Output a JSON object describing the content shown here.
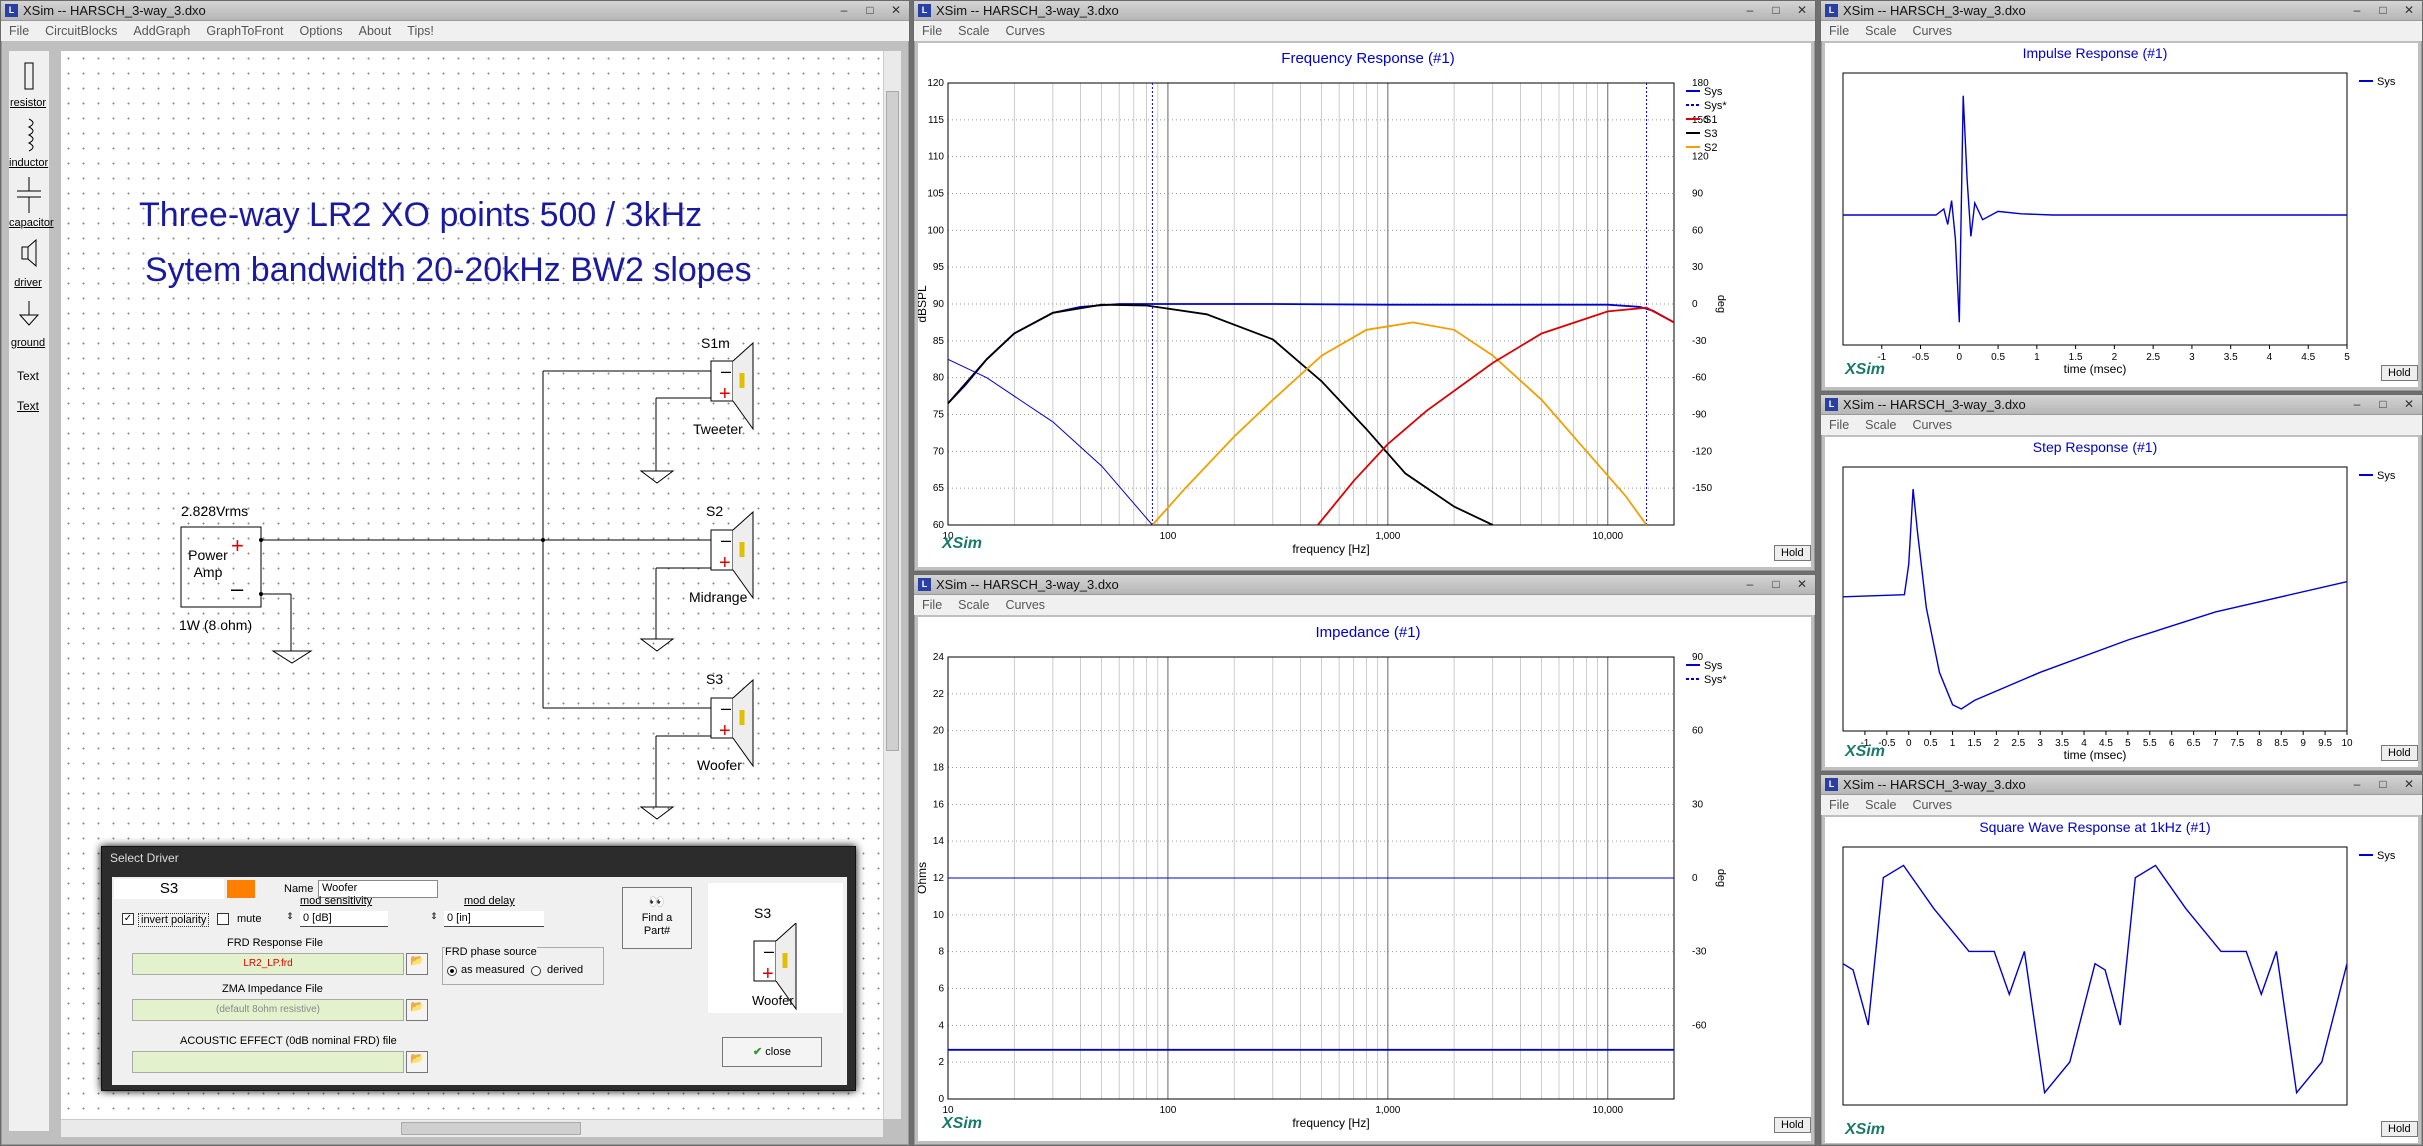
{
  "windows": {
    "circuit": {
      "title": "XSim -- HARSCH_3-way_3.dxo",
      "menu": [
        "File",
        "CircuitBlocks",
        "AddGraph",
        "GraphToFront",
        "Options",
        "About",
        "Tips!"
      ]
    },
    "freq": {
      "title": "XSim -- HARSCH_3-way_3.dxo",
      "menu": [
        "File",
        "Scale",
        "Curves"
      ]
    },
    "impedance": {
      "title": "XSim -- HARSCH_3-way_3.dxo",
      "menu": [
        "File",
        "Scale",
        "Curves"
      ]
    },
    "impulse": {
      "title": "XSim -- HARSCH_3-way_3.dxo",
      "menu": [
        "File",
        "Scale",
        "Curves"
      ]
    },
    "step": {
      "title": "XSim -- HARSCH_3-way_3.dxo",
      "menu": [
        "File",
        "Scale",
        "Curves"
      ]
    },
    "square": {
      "title": "XSim -- HARSCH_3-way_3.dxo",
      "menu": [
        "File",
        "Scale",
        "Curves"
      ]
    }
  },
  "toolbox": [
    "resistor",
    "inductor",
    "capacitor",
    "driver",
    "ground",
    "Text",
    "Text"
  ],
  "circuit": {
    "heading1": "Three-way LR2 XO points 500 / 3kHz",
    "heading2": "Sytem bandwidth 20-20kHz BW2 slopes",
    "amp_voltage": "2.828Vrms",
    "amp_label1": "Power",
    "amp_label2": "Amp",
    "amp_power": "1W (8 ohm)",
    "drivers": [
      {
        "id": "S1m",
        "name": "Tweeter"
      },
      {
        "id": "S2",
        "name": "Midrange"
      },
      {
        "id": "S3",
        "name": "Woofer"
      }
    ]
  },
  "dialog": {
    "title": "Select Driver",
    "driver_id": "S3",
    "color": "#ff8000",
    "name_label": "Name",
    "name_value": "Woofer",
    "mod_sensitivity_label": "mod sensitivity",
    "mod_sensitivity_value": "0 [dB]",
    "mod_delay_label": "mod delay",
    "mod_delay_value": "0 [in]",
    "invert_polarity": "invert polarity",
    "mute": "mute",
    "frd_label": "FRD Response File",
    "frd_value": "LR2_LP.frd",
    "zma_label": "ZMA Impedance File",
    "zma_value": "(default 8ohm resistive)",
    "acoustic_label": "ACOUSTIC EFFECT (0dB nominal FRD) file",
    "acoustic_value": "",
    "phase_source_label": "FRD phase source",
    "phase_measured": "as measured",
    "phase_derived": "derived",
    "find_part": "Find a Part#",
    "preview_id": "S3",
    "preview_name": "Woofer",
    "close": "close"
  },
  "brand": "XSim",
  "hold": "Hold",
  "colors": {
    "sys": "#0000cc",
    "s1": "#dd0000",
    "s3": "#000000",
    "s2": "#f0a000",
    "title": "#0000cc"
  },
  "chart_data": [
    {
      "type": "line",
      "title": "Frequency Response (#1)",
      "xlabel": "frequency [Hz]",
      "ylabel": "dBSPL",
      "y2label": "deg",
      "x_scale": "log",
      "xlim": [
        10,
        20000
      ],
      "ylim": [
        60,
        120
      ],
      "y2lim": [
        -180,
        180
      ],
      "xticks": [
        "10",
        "100",
        "1,000",
        "10,000"
      ],
      "yticks": [
        "60",
        "65",
        "70",
        "75",
        "80",
        "85",
        "90",
        "95",
        "100",
        "105",
        "110",
        "115",
        "120"
      ],
      "y2ticks": [
        "-150",
        "-120",
        "-90",
        "-60",
        "-30",
        "0",
        "30",
        "60",
        "90",
        "120",
        "150",
        "180"
      ],
      "legend": [
        "Sys",
        "Sys*",
        "S1",
        "S3",
        "S2"
      ],
      "series": [
        {
          "name": "Sys",
          "x": [
            10,
            12,
            15,
            20,
            30,
            40,
            60,
            85,
            150,
            300,
            1000,
            3000,
            10000,
            14000,
            16000,
            20000
          ],
          "y": [
            76.5,
            79,
            82.5,
            86,
            88.8,
            89.6,
            90,
            90,
            90,
            90,
            89.9,
            89.9,
            89.9,
            89.6,
            89.1,
            87.5
          ]
        },
        {
          "name": "S3",
          "x": [
            10,
            15,
            20,
            30,
            50,
            80,
            150,
            300,
            500,
            800,
            1200,
            2000,
            3000
          ],
          "y": [
            76.5,
            82.5,
            86,
            88.8,
            89.9,
            89.8,
            88.6,
            85.2,
            79.5,
            73,
            67,
            62.5,
            60
          ]
        },
        {
          "name": "S2",
          "x": [
            85,
            120,
            200,
            300,
            500,
            800,
            1300,
            2000,
            3000,
            5000,
            8000,
            12000,
            15000
          ],
          "y": [
            60,
            65,
            72,
            77,
            83,
            86.5,
            87.5,
            86.5,
            83,
            77,
            70,
            64,
            60
          ]
        },
        {
          "name": "S1",
          "x": [
            480,
            700,
            1000,
            1500,
            3000,
            5000,
            10000,
            15000,
            20000
          ],
          "y": [
            60,
            66,
            71,
            75.5,
            82,
            86,
            89,
            89.5,
            87.5
          ]
        },
        {
          "name": "Sys*",
          "x": [
            10,
            15,
            20,
            30,
            50,
            85
          ],
          "y": [
            82.5,
            80,
            77.5,
            74,
            68,
            60
          ]
        }
      ]
    },
    {
      "type": "line",
      "title": "Impedance (#1)",
      "xlabel": "frequency [Hz]",
      "ylabel": "Ohms",
      "y2label": "deg",
      "x_scale": "log",
      "xlim": [
        10,
        20000
      ],
      "ylim": [
        0,
        24
      ],
      "y2lim": [
        -90,
        90
      ],
      "xticks": [
        "10",
        "100",
        "1,000",
        "10,000"
      ],
      "yticks": [
        "0",
        "2",
        "4",
        "6",
        "8",
        "10",
        "12",
        "14",
        "16",
        "18",
        "20",
        "22",
        "24"
      ],
      "y2ticks": [
        "-60",
        "-30",
        "0",
        "30",
        "60",
        "90"
      ],
      "legend": [
        "Sys",
        "Sys*"
      ],
      "series": [
        {
          "name": "Sys",
          "x": [
            10,
            20000
          ],
          "y": [
            2.67,
            2.67
          ]
        },
        {
          "name": "Sys*",
          "x": [
            10,
            20000
          ],
          "y": [
            12,
            12
          ]
        }
      ]
    },
    {
      "type": "line",
      "title": "Impulse Response (#1)",
      "xlabel": "time (msec)",
      "xlim": [
        -1.5,
        5
      ],
      "xticks": [
        "-1",
        "-0.5",
        "0",
        "0.5",
        "1",
        "1.5",
        "2",
        "2.5",
        "3",
        "3.5",
        "4",
        "4.5",
        "5"
      ],
      "legend": [
        "Sys"
      ],
      "series": [
        {
          "name": "Sys",
          "x": [
            -1.5,
            -0.3,
            -0.2,
            -0.15,
            -0.1,
            -0.05,
            0,
            0.05,
            0.1,
            0.15,
            0.2,
            0.3,
            0.5,
            0.8,
            1.2,
            5
          ],
          "y": [
            0,
            0,
            0.05,
            -0.08,
            0.12,
            -0.2,
            -0.9,
            1,
            0.3,
            -0.18,
            0.1,
            -0.04,
            0.03,
            0.01,
            0,
            0
          ]
        }
      ]
    },
    {
      "type": "line",
      "title": "Step Response (#1)",
      "xlabel": "time (msec)",
      "xlim": [
        -1.5,
        10
      ],
      "xticks": [
        "-1",
        "-0.5",
        "0",
        "0.5",
        "1",
        "1.5",
        "2",
        "2.5",
        "3",
        "3.5",
        "4",
        "4.5",
        "5",
        "5.5",
        "6",
        "6.5",
        "7",
        "7.5",
        "8",
        "8.5",
        "9",
        "9.5",
        "10"
      ],
      "legend": [
        "Sys"
      ],
      "series": [
        {
          "name": "Sys",
          "x": [
            -1.5,
            -0.1,
            0,
            0.1,
            0.2,
            0.4,
            0.7,
            1.0,
            1.2,
            1.5,
            3,
            5,
            7,
            10
          ],
          "y": [
            0.05,
            0.06,
            0.2,
            0.55,
            0.35,
            0.0,
            -0.3,
            -0.45,
            -0.47,
            -0.43,
            -0.3,
            -0.15,
            -0.02,
            0.12
          ]
        }
      ]
    },
    {
      "type": "line",
      "title": "Square Wave Response at 1kHz (#1)",
      "legend": [
        "Sys"
      ],
      "series": [
        {
          "name": "Sys",
          "x": [
            0,
            0.02,
            0.05,
            0.08,
            0.12,
            0.18,
            0.25,
            0.3,
            0.33,
            0.36,
            0.4,
            0.45,
            0.5,
            0.52,
            0.55,
            0.58,
            0.62,
            0.68,
            0.75,
            0.8,
            0.83,
            0.86,
            0.9,
            0.95,
            1
          ],
          "y": [
            0.1,
            0.05,
            -0.4,
            0.8,
            0.9,
            0.55,
            0.2,
            0.2,
            -0.15,
            0.2,
            -0.95,
            -0.7,
            0.1,
            0.05,
            -0.4,
            0.8,
            0.9,
            0.55,
            0.2,
            0.2,
            -0.15,
            0.2,
            -0.95,
            -0.7,
            0.1
          ]
        }
      ]
    }
  ]
}
